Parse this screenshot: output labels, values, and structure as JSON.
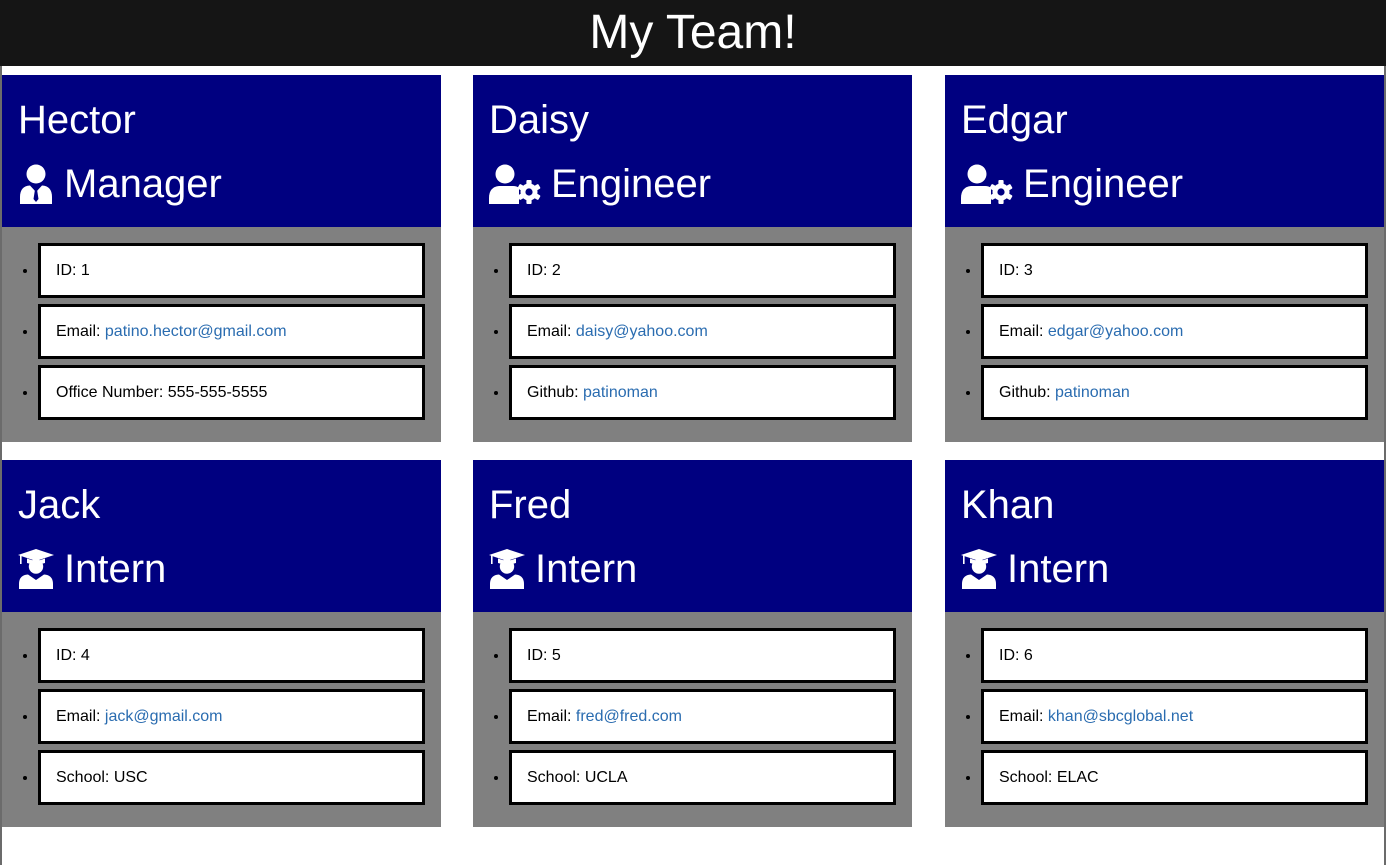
{
  "header": {
    "title": "My Team!"
  },
  "cards": [
    {
      "name": "Hector",
      "role": "Manager",
      "icon": "manager-icon",
      "id_label": "ID: 1",
      "email_prefix": "Email: ",
      "email": "patino.hector@gmail.com",
      "extra_prefix": "Office Number: ",
      "extra_value": "555-555-5555",
      "extra_is_link": false
    },
    {
      "name": "Daisy",
      "role": "Engineer",
      "icon": "engineer-icon",
      "id_label": "ID: 2",
      "email_prefix": "Email: ",
      "email": "daisy@yahoo.com",
      "extra_prefix": "Github: ",
      "extra_value": "patinoman",
      "extra_is_link": true
    },
    {
      "name": "Edgar",
      "role": "Engineer",
      "icon": "engineer-icon",
      "id_label": "ID: 3",
      "email_prefix": "Email: ",
      "email": "edgar@yahoo.com",
      "extra_prefix": "Github: ",
      "extra_value": "patinoman",
      "extra_is_link": true
    },
    {
      "name": "Jack",
      "role": "Intern",
      "icon": "intern-graduate-icon",
      "id_label": "ID: 4",
      "email_prefix": "Email: ",
      "email": "jack@gmail.com",
      "extra_prefix": "School: ",
      "extra_value": "USC",
      "extra_is_link": false
    },
    {
      "name": "Fred",
      "role": "Intern",
      "icon": "intern-graduate-icon",
      "id_label": "ID: 5",
      "email_prefix": "Email: ",
      "email": "fred@fred.com",
      "extra_prefix": "School: ",
      "extra_value": "UCLA",
      "extra_is_link": false
    },
    {
      "name": "Khan",
      "role": "Intern",
      "icon": "intern-graduate-icon",
      "id_label": "ID: 6",
      "email_prefix": "Email: ",
      "email": "khan@sbcglobal.net",
      "extra_prefix": "School: ",
      "extra_value": "ELAC",
      "extra_is_link": false
    }
  ],
  "colors": {
    "header_bg": "#151515",
    "card_head_bg": "#000080",
    "card_body_bg": "#808080",
    "link": "#2a6cb0"
  }
}
